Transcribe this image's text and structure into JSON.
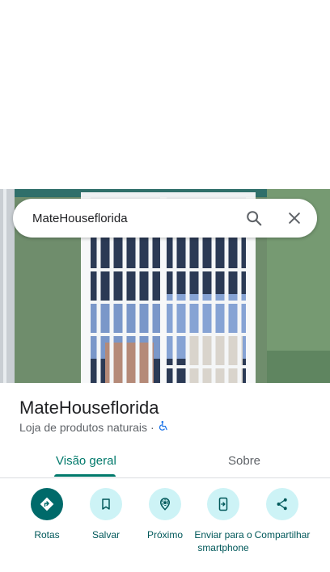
{
  "search": {
    "query": "MateHouseflorida"
  },
  "place": {
    "name": "MateHouseflorida",
    "category": "Loja de produtos naturais",
    "separator": "·"
  },
  "tabs": [
    {
      "label": "Visão geral",
      "active": true
    },
    {
      "label": "Sobre",
      "active": false
    }
  ],
  "actions": [
    {
      "label": "Rotas",
      "icon": "directions-icon"
    },
    {
      "label": "Salvar",
      "icon": "bookmark-icon"
    },
    {
      "label": "Próximo",
      "icon": "nearby-icon"
    },
    {
      "label": "Enviar para o smartphone",
      "icon": "send-to-phone-icon"
    },
    {
      "label": "Compartilhar",
      "icon": "share-icon"
    }
  ],
  "colors": {
    "accent": "#00796b",
    "action_bg": "#cdf3f6",
    "primary_action": "#006a6a"
  }
}
